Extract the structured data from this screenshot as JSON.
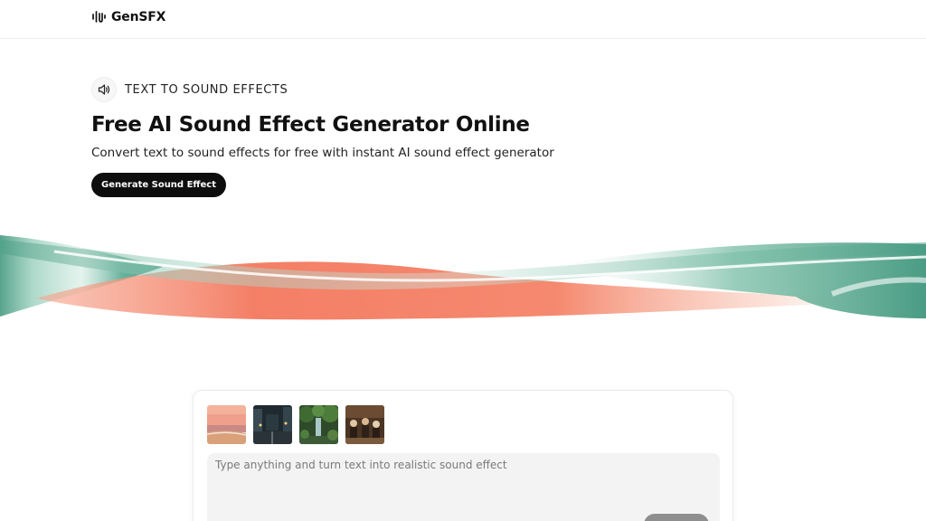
{
  "navbar": {
    "brand_name": "GenSFX",
    "brand_icon": "waveform-icon"
  },
  "hero": {
    "eyebrow_icon": "speaker-icon",
    "eyebrow": "TEXT TO SOUND EFFECTS",
    "title": "Free AI Sound Effect Generator Online",
    "subtitle": "Convert text to sound effects for free with instant AI sound effect generator",
    "cta_label": "Generate Sound Effect"
  },
  "generator": {
    "thumbnails": [
      "beach-sunset",
      "rainy-city-street",
      "forest-waterfall",
      "orchestra-hall"
    ],
    "prompt_placeholder": "Type anything and turn text into realistic sound effect",
    "prompt_value": ""
  },
  "colors": {
    "cta_bg": "#0d0d0d",
    "wave_green": "#5fae96",
    "wave_coral": "#f47f66"
  }
}
